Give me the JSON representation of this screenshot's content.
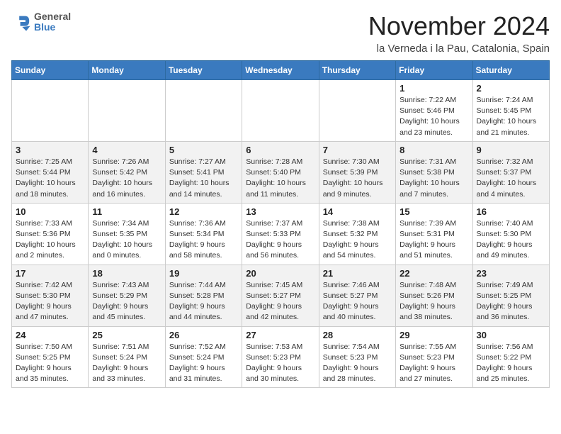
{
  "header": {
    "logo_line1": "General",
    "logo_line2": "Blue",
    "month": "November 2024",
    "location": "la Verneda i la Pau, Catalonia, Spain"
  },
  "weekdays": [
    "Sunday",
    "Monday",
    "Tuesday",
    "Wednesday",
    "Thursday",
    "Friday",
    "Saturday"
  ],
  "weeks": [
    [
      {
        "day": "",
        "info": ""
      },
      {
        "day": "",
        "info": ""
      },
      {
        "day": "",
        "info": ""
      },
      {
        "day": "",
        "info": ""
      },
      {
        "day": "",
        "info": ""
      },
      {
        "day": "1",
        "info": "Sunrise: 7:22 AM\nSunset: 5:46 PM\nDaylight: 10 hours\nand 23 minutes."
      },
      {
        "day": "2",
        "info": "Sunrise: 7:24 AM\nSunset: 5:45 PM\nDaylight: 10 hours\nand 21 minutes."
      }
    ],
    [
      {
        "day": "3",
        "info": "Sunrise: 7:25 AM\nSunset: 5:44 PM\nDaylight: 10 hours\nand 18 minutes."
      },
      {
        "day": "4",
        "info": "Sunrise: 7:26 AM\nSunset: 5:42 PM\nDaylight: 10 hours\nand 16 minutes."
      },
      {
        "day": "5",
        "info": "Sunrise: 7:27 AM\nSunset: 5:41 PM\nDaylight: 10 hours\nand 14 minutes."
      },
      {
        "day": "6",
        "info": "Sunrise: 7:28 AM\nSunset: 5:40 PM\nDaylight: 10 hours\nand 11 minutes."
      },
      {
        "day": "7",
        "info": "Sunrise: 7:30 AM\nSunset: 5:39 PM\nDaylight: 10 hours\nand 9 minutes."
      },
      {
        "day": "8",
        "info": "Sunrise: 7:31 AM\nSunset: 5:38 PM\nDaylight: 10 hours\nand 7 minutes."
      },
      {
        "day": "9",
        "info": "Sunrise: 7:32 AM\nSunset: 5:37 PM\nDaylight: 10 hours\nand 4 minutes."
      }
    ],
    [
      {
        "day": "10",
        "info": "Sunrise: 7:33 AM\nSunset: 5:36 PM\nDaylight: 10 hours\nand 2 minutes."
      },
      {
        "day": "11",
        "info": "Sunrise: 7:34 AM\nSunset: 5:35 PM\nDaylight: 10 hours\nand 0 minutes."
      },
      {
        "day": "12",
        "info": "Sunrise: 7:36 AM\nSunset: 5:34 PM\nDaylight: 9 hours\nand 58 minutes."
      },
      {
        "day": "13",
        "info": "Sunrise: 7:37 AM\nSunset: 5:33 PM\nDaylight: 9 hours\nand 56 minutes."
      },
      {
        "day": "14",
        "info": "Sunrise: 7:38 AM\nSunset: 5:32 PM\nDaylight: 9 hours\nand 54 minutes."
      },
      {
        "day": "15",
        "info": "Sunrise: 7:39 AM\nSunset: 5:31 PM\nDaylight: 9 hours\nand 51 minutes."
      },
      {
        "day": "16",
        "info": "Sunrise: 7:40 AM\nSunset: 5:30 PM\nDaylight: 9 hours\nand 49 minutes."
      }
    ],
    [
      {
        "day": "17",
        "info": "Sunrise: 7:42 AM\nSunset: 5:30 PM\nDaylight: 9 hours\nand 47 minutes."
      },
      {
        "day": "18",
        "info": "Sunrise: 7:43 AM\nSunset: 5:29 PM\nDaylight: 9 hours\nand 45 minutes."
      },
      {
        "day": "19",
        "info": "Sunrise: 7:44 AM\nSunset: 5:28 PM\nDaylight: 9 hours\nand 44 minutes."
      },
      {
        "day": "20",
        "info": "Sunrise: 7:45 AM\nSunset: 5:27 PM\nDaylight: 9 hours\nand 42 minutes."
      },
      {
        "day": "21",
        "info": "Sunrise: 7:46 AM\nSunset: 5:27 PM\nDaylight: 9 hours\nand 40 minutes."
      },
      {
        "day": "22",
        "info": "Sunrise: 7:48 AM\nSunset: 5:26 PM\nDaylight: 9 hours\nand 38 minutes."
      },
      {
        "day": "23",
        "info": "Sunrise: 7:49 AM\nSunset: 5:25 PM\nDaylight: 9 hours\nand 36 minutes."
      }
    ],
    [
      {
        "day": "24",
        "info": "Sunrise: 7:50 AM\nSunset: 5:25 PM\nDaylight: 9 hours\nand 35 minutes."
      },
      {
        "day": "25",
        "info": "Sunrise: 7:51 AM\nSunset: 5:24 PM\nDaylight: 9 hours\nand 33 minutes."
      },
      {
        "day": "26",
        "info": "Sunrise: 7:52 AM\nSunset: 5:24 PM\nDaylight: 9 hours\nand 31 minutes."
      },
      {
        "day": "27",
        "info": "Sunrise: 7:53 AM\nSunset: 5:23 PM\nDaylight: 9 hours\nand 30 minutes."
      },
      {
        "day": "28",
        "info": "Sunrise: 7:54 AM\nSunset: 5:23 PM\nDaylight: 9 hours\nand 28 minutes."
      },
      {
        "day": "29",
        "info": "Sunrise: 7:55 AM\nSunset: 5:23 PM\nDaylight: 9 hours\nand 27 minutes."
      },
      {
        "day": "30",
        "info": "Sunrise: 7:56 AM\nSunset: 5:22 PM\nDaylight: 9 hours\nand 25 minutes."
      }
    ]
  ]
}
